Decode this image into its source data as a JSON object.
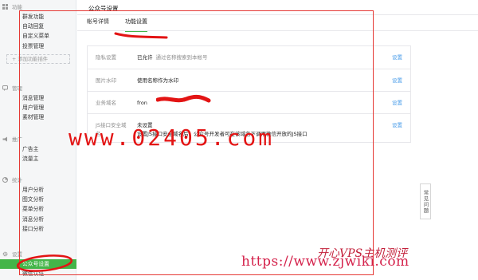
{
  "sidebar": {
    "groups": [
      {
        "title": "功能",
        "icon": "grid-icon",
        "items": [
          "群发功能",
          "自动回复",
          "自定义菜单",
          "投票管理"
        ],
        "add_plugin": "+ 添加功能插件"
      },
      {
        "title": "管理",
        "icon": "message-icon",
        "items": [
          "消息管理",
          "用户管理",
          "素材管理"
        ]
      },
      {
        "title": "推广",
        "icon": "megaphone-icon",
        "items": [
          "广告主",
          "流量主"
        ]
      },
      {
        "title": "统计",
        "icon": "chart-icon",
        "items": [
          "用户分析",
          "图文分析",
          "菜单分析",
          "消息分析",
          "接口分析"
        ]
      },
      {
        "title": "设置",
        "icon": "gear-icon",
        "items": [
          "公众号设置",
          "微信认证"
        ]
      }
    ],
    "active_item": "公众号设置"
  },
  "main": {
    "page_title": "公众号设置",
    "tabs": [
      {
        "label": "帐号详情",
        "active": false
      },
      {
        "label": "功能设置",
        "active": true
      }
    ],
    "settings": [
      {
        "label": "隐私设置",
        "value": "已允许",
        "desc": "通过名称搜索到本帐号",
        "action": "设置"
      },
      {
        "label": "图片水印",
        "value": "使用名称作为水印",
        "desc": "",
        "action": "设置"
      },
      {
        "label": "业务域名",
        "value": "fron",
        "desc": "",
        "action": "设置"
      },
      {
        "label": "JS接口安全域名",
        "value": "未设置",
        "desc": "设置JS接口安全域名后，公众号开发者可在该域名下调用微信开放的JS接口",
        "action": "设置"
      }
    ],
    "help_button": "常见问题"
  },
  "overlays": {
    "watermark_url": "www.02405.com",
    "watermark_site": "https://www.zjwiki.com",
    "watermark_brand": "开心VPS主机测评",
    "annotation_color": "#e53935"
  }
}
